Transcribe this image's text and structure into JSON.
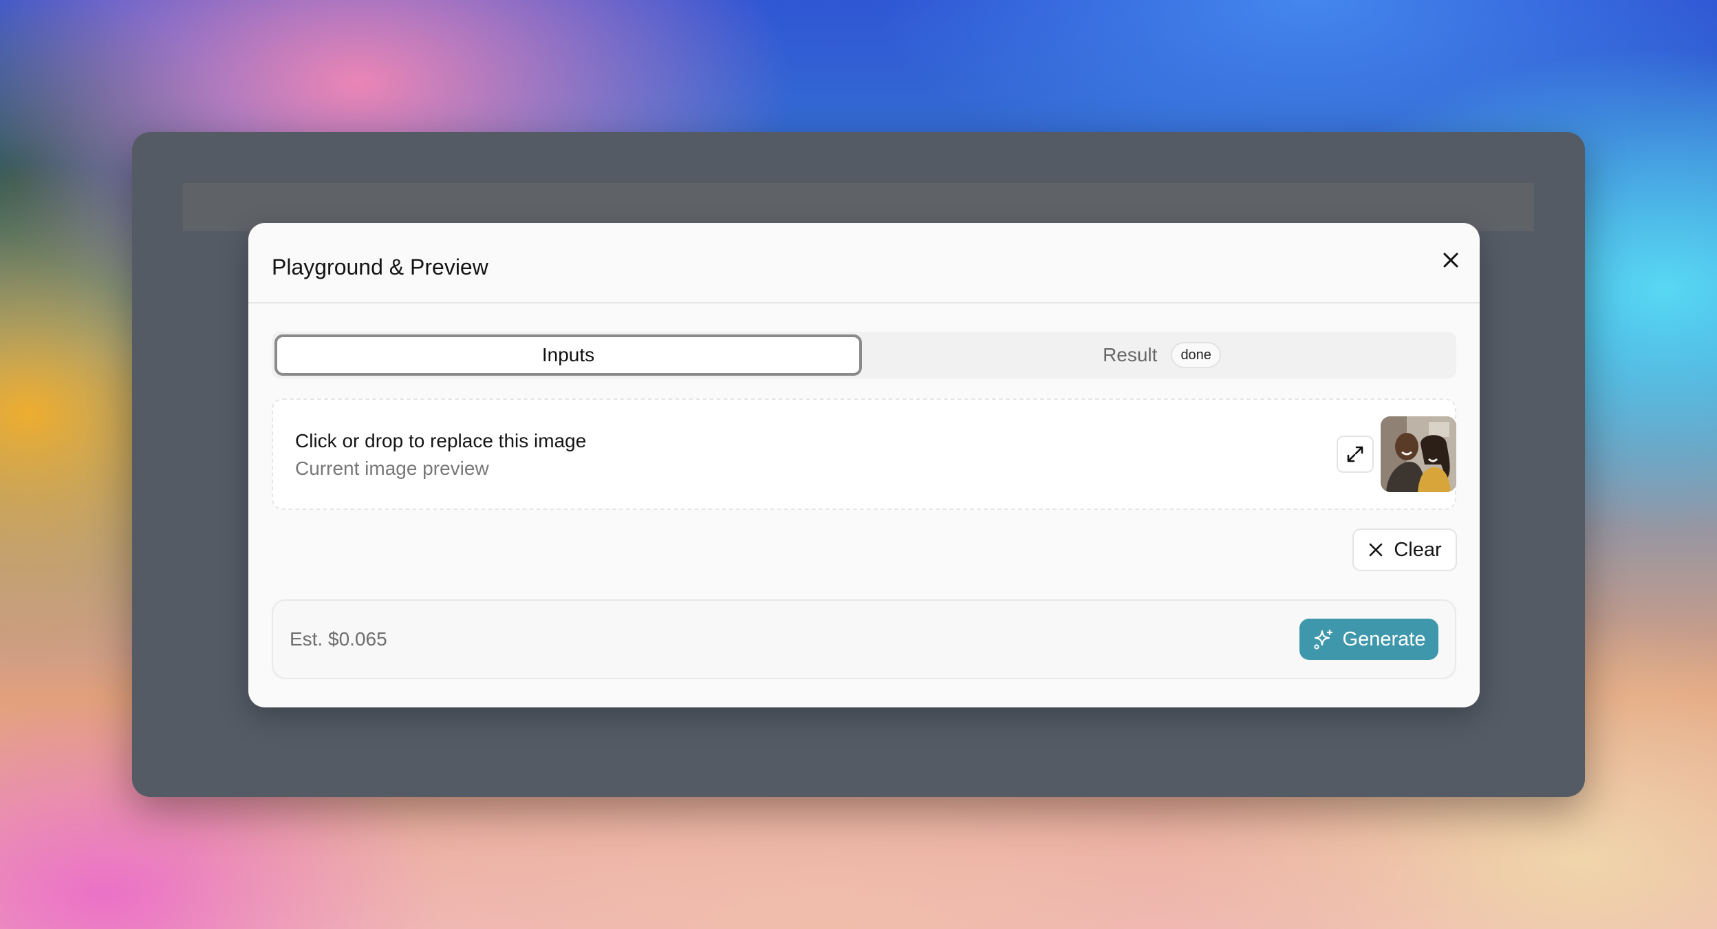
{
  "dialog": {
    "title": "Playground & Preview"
  },
  "tabs": [
    {
      "label": "Inputs",
      "active": true
    },
    {
      "label": "Result",
      "badge": "done",
      "active": false
    }
  ],
  "dropzone": {
    "title": "Click or drop to replace this image",
    "subtitle": "Current image preview"
  },
  "actions": {
    "clear_label": "Clear",
    "estimate": "Est. $0.065",
    "generate_label": "Generate"
  },
  "icons": {
    "close": "close-icon",
    "expand": "expand-icon",
    "clear": "x-icon",
    "generate": "sparkles-icon"
  },
  "colors": {
    "accent": "#3f97ab",
    "window": "#545b65",
    "dialog": "#fafafa"
  }
}
